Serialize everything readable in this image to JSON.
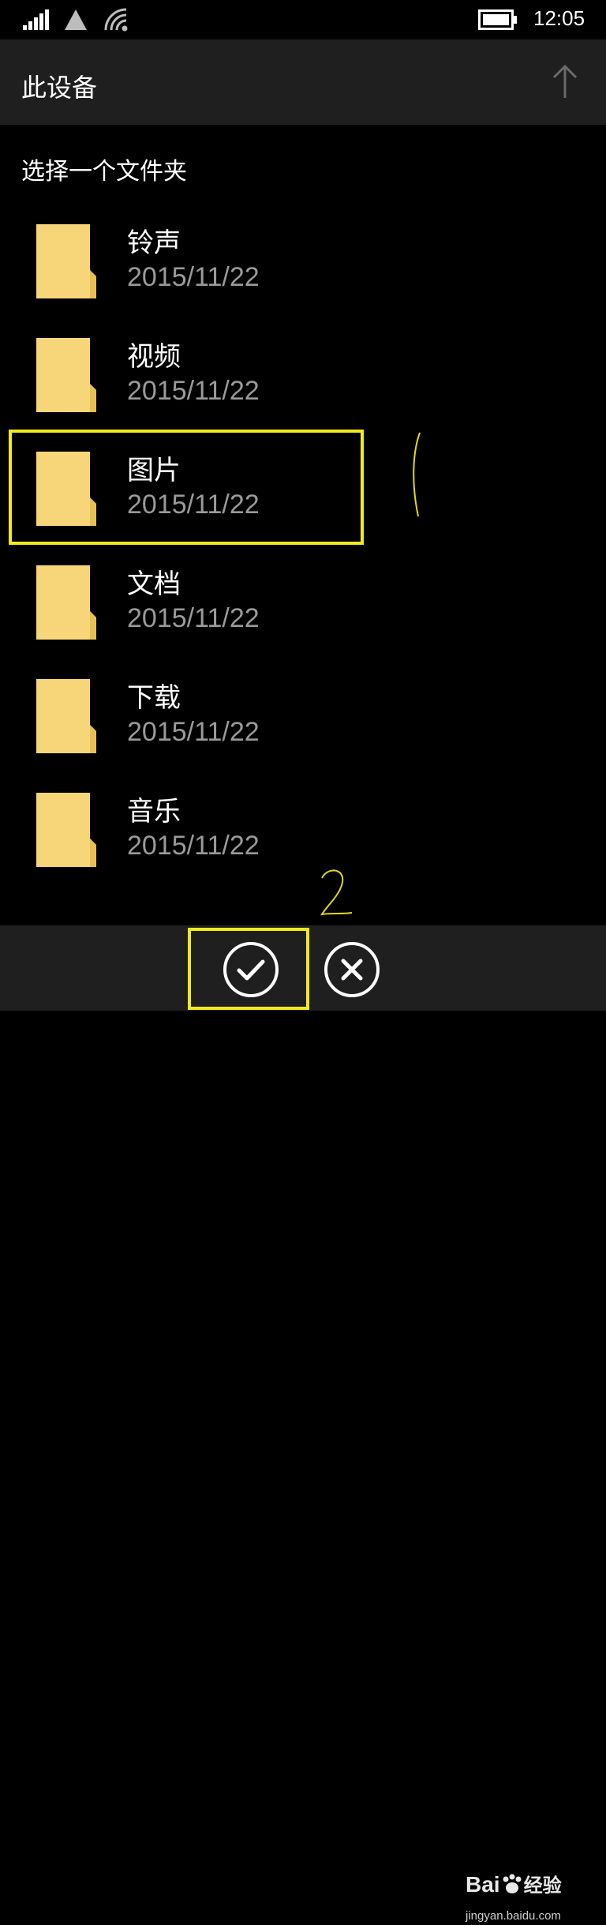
{
  "status_bar": {
    "time": "12:05",
    "icons": [
      "signal-icon",
      "navigation-arrow-icon",
      "wifi-icon",
      "battery-icon"
    ]
  },
  "header": {
    "title": "此设备",
    "up_icon": "arrow-up-icon"
  },
  "subtitle": "选择一个文件夹",
  "folders": [
    {
      "name": "铃声",
      "date": "2015/11/22"
    },
    {
      "name": "视频",
      "date": "2015/11/22"
    },
    {
      "name": "图片",
      "date": "2015/11/22"
    },
    {
      "name": "文档",
      "date": "2015/11/22"
    },
    {
      "name": "下载",
      "date": "2015/11/22"
    },
    {
      "name": "音乐",
      "date": "2015/11/22"
    }
  ],
  "app_bar": {
    "confirm_icon": "checkmark-icon",
    "cancel_icon": "close-icon"
  },
  "watermark": {
    "logo_latin": "Bai",
    "logo_cn": "经验",
    "url": "jingyan.baidu.com"
  },
  "colors": {
    "background": "#000000",
    "bar": "#1f1f1f",
    "date_text": "#9a9a9a",
    "folder": "#f7d67a",
    "highlight": "#f2ea1a"
  }
}
